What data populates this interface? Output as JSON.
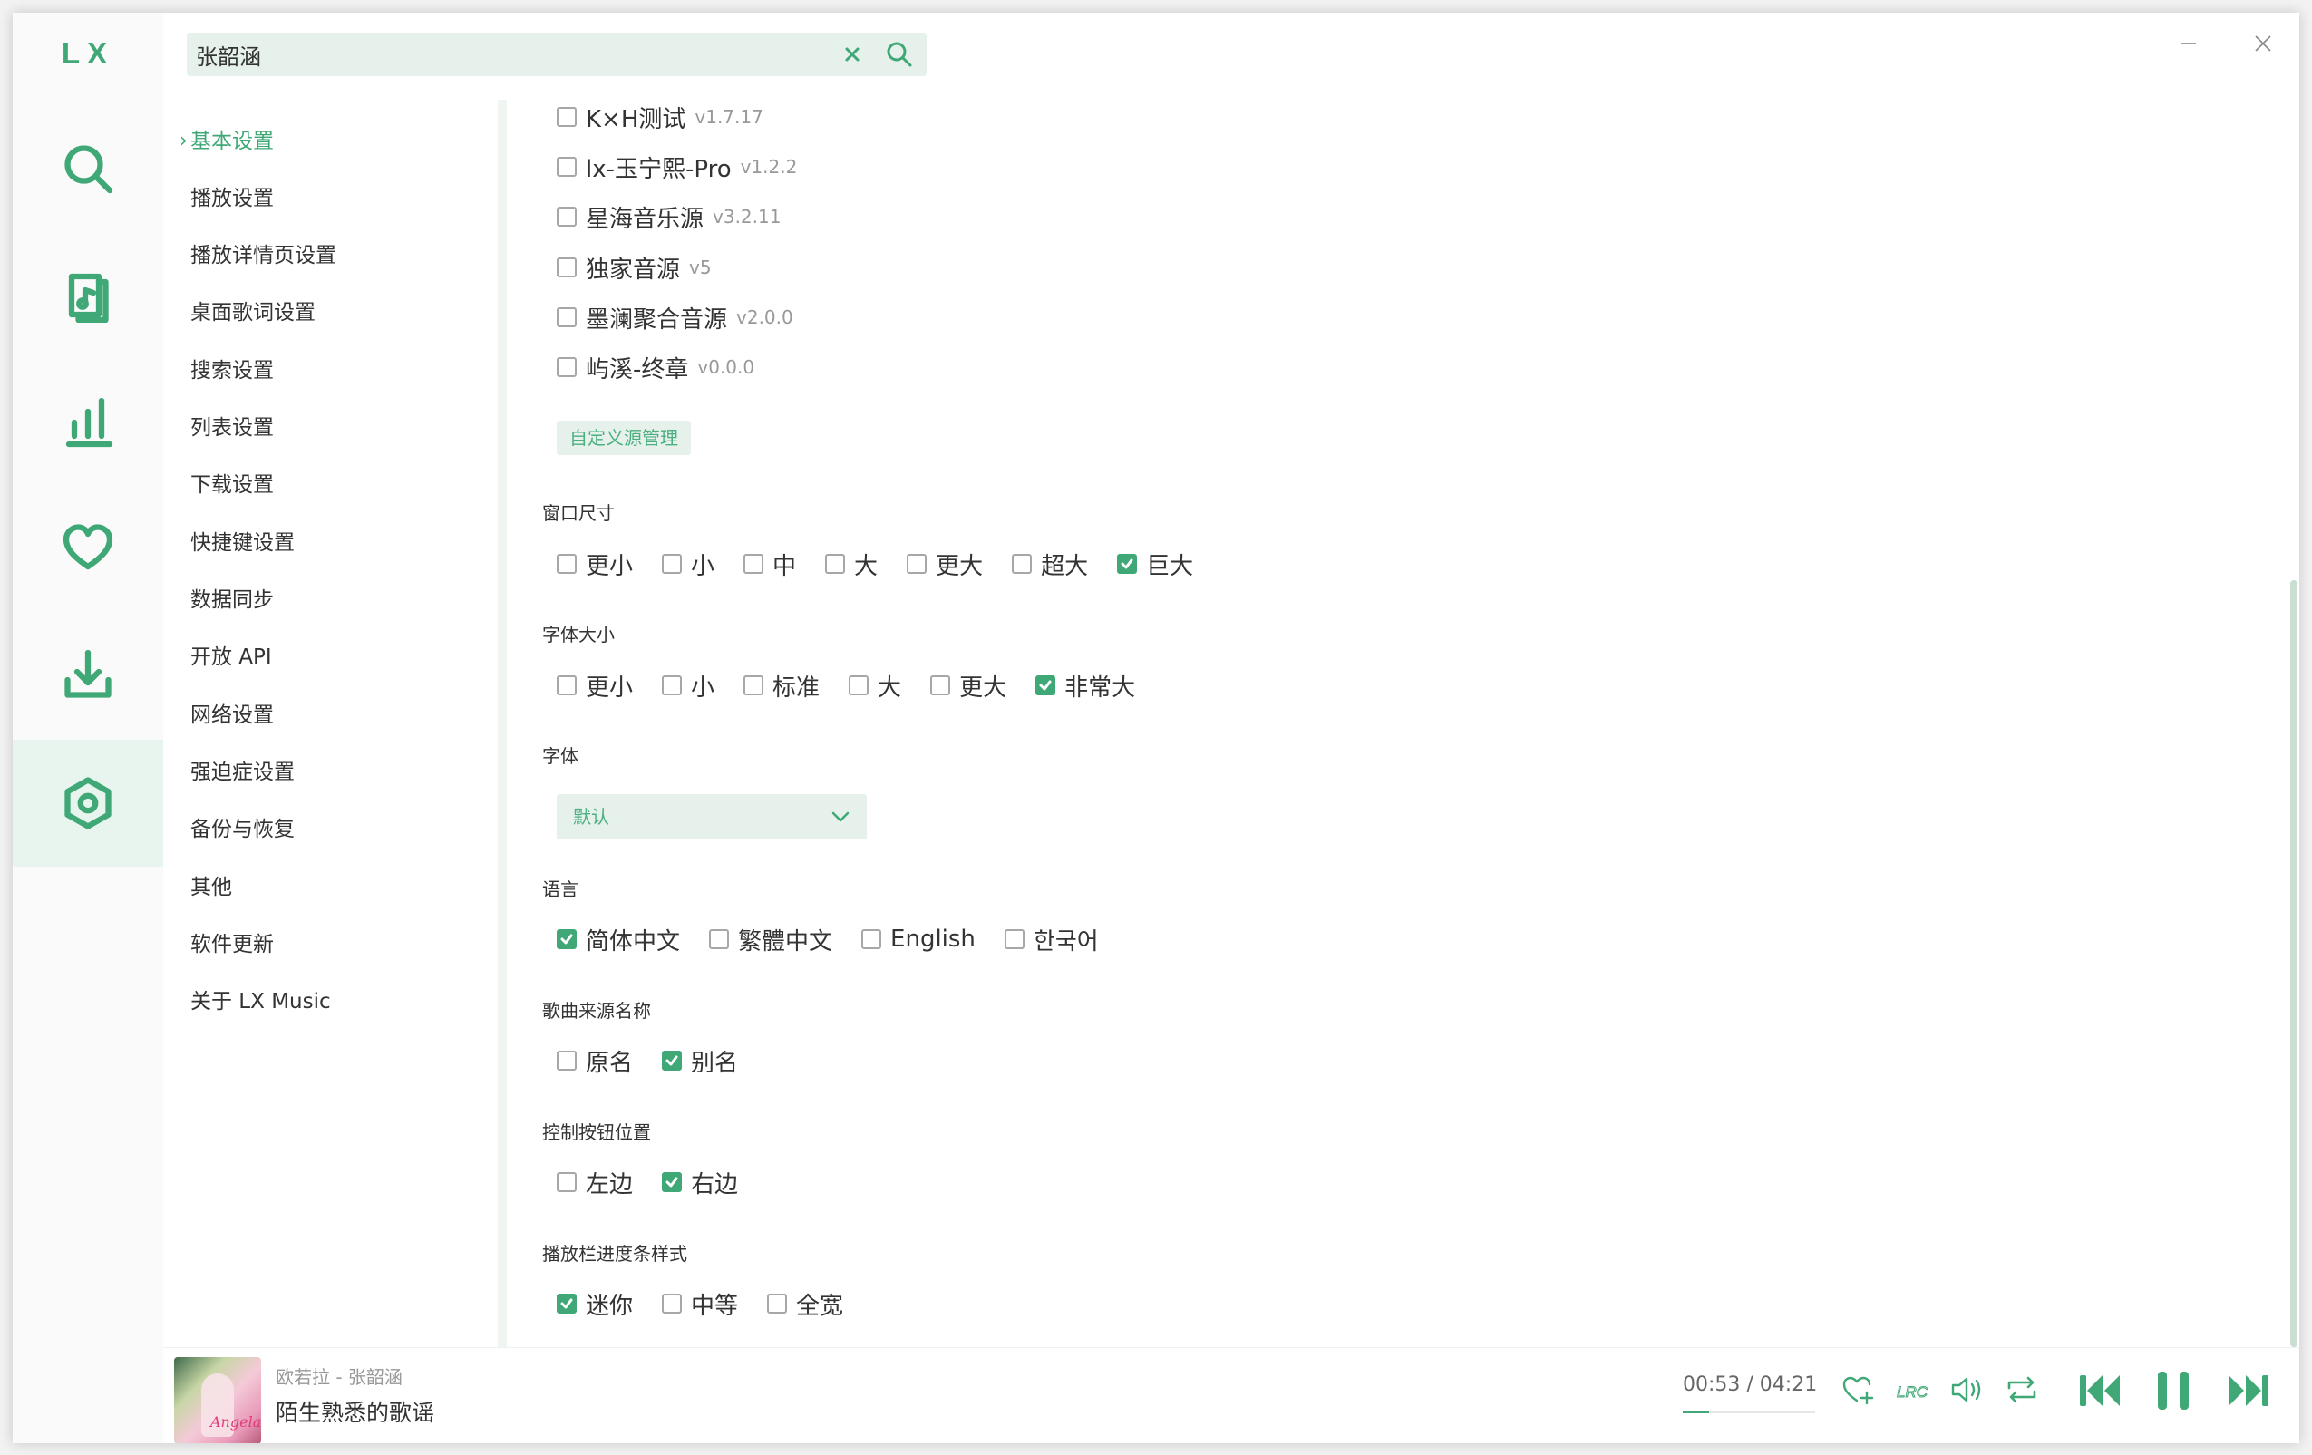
{
  "app": {
    "logo": "LX"
  },
  "colors": {
    "accent": "#3fa876",
    "accent_light": "#e5f1ea"
  },
  "nav": [
    {
      "name": "search",
      "icon": "search-icon"
    },
    {
      "name": "songlist",
      "icon": "music-file-icon"
    },
    {
      "name": "leaderboard",
      "icon": "chart-icon"
    },
    {
      "name": "favorites",
      "icon": "heart-icon"
    },
    {
      "name": "download",
      "icon": "download-icon"
    },
    {
      "name": "settings",
      "icon": "settings-icon",
      "active": true
    }
  ],
  "search": {
    "value": "张韶涵",
    "placeholder": ""
  },
  "settings_nav": [
    {
      "label": "基本设置",
      "active": true
    },
    {
      "label": "播放设置"
    },
    {
      "label": "播放详情页设置"
    },
    {
      "label": "桌面歌词设置"
    },
    {
      "label": "搜索设置"
    },
    {
      "label": "列表设置"
    },
    {
      "label": "下载设置"
    },
    {
      "label": "快捷键设置"
    },
    {
      "label": "数据同步"
    },
    {
      "label": "开放 API"
    },
    {
      "label": "网络设置"
    },
    {
      "label": "强迫症设置"
    },
    {
      "label": "备份与恢复"
    },
    {
      "label": "其他"
    },
    {
      "label": "软件更新"
    },
    {
      "label": "关于 LX Music"
    }
  ],
  "sources": [
    {
      "name": "K×H测试",
      "version": "v1.7.17",
      "checked": false
    },
    {
      "name": "lx-玉宁熙-Pro",
      "version": "v1.2.2",
      "checked": false
    },
    {
      "name": "星海音乐源",
      "version": "v3.2.11",
      "checked": false
    },
    {
      "name": "独家音源",
      "version": "v5",
      "checked": false
    },
    {
      "name": "墨澜聚合音源",
      "version": "v2.0.0",
      "checked": false
    },
    {
      "name": "屿溪-终章",
      "version": "v0.0.0",
      "checked": false
    }
  ],
  "custom_source_button": "自定义源管理",
  "window_size": {
    "title": "窗口尺寸",
    "options": [
      {
        "label": "更小",
        "checked": false
      },
      {
        "label": "小",
        "checked": false
      },
      {
        "label": "中",
        "checked": false
      },
      {
        "label": "大",
        "checked": false
      },
      {
        "label": "更大",
        "checked": false
      },
      {
        "label": "超大",
        "checked": false
      },
      {
        "label": "巨大",
        "checked": true
      }
    ]
  },
  "font_size": {
    "title": "字体大小",
    "options": [
      {
        "label": "更小",
        "checked": false
      },
      {
        "label": "小",
        "checked": false
      },
      {
        "label": "标准",
        "checked": false
      },
      {
        "label": "大",
        "checked": false
      },
      {
        "label": "更大",
        "checked": false
      },
      {
        "label": "非常大",
        "checked": true
      }
    ]
  },
  "font": {
    "title": "字体",
    "value": "默认"
  },
  "language": {
    "title": "语言",
    "options": [
      {
        "label": "简体中文",
        "checked": true
      },
      {
        "label": "繁體中文",
        "checked": false
      },
      {
        "label": "English",
        "checked": false
      },
      {
        "label": "한국어",
        "checked": false
      }
    ]
  },
  "source_name": {
    "title": "歌曲来源名称",
    "options": [
      {
        "label": "原名",
        "checked": false
      },
      {
        "label": "别名",
        "checked": true
      }
    ]
  },
  "control_position": {
    "title": "控制按钮位置",
    "options": [
      {
        "label": "左边",
        "checked": false
      },
      {
        "label": "右边",
        "checked": true
      }
    ]
  },
  "progress_style": {
    "title": "播放栏进度条样式",
    "options": [
      {
        "label": "迷你",
        "checked": true
      },
      {
        "label": "中等",
        "checked": false
      },
      {
        "label": "全宽",
        "checked": false
      }
    ]
  },
  "player": {
    "meta": "欧若拉 - 张韶涵",
    "song": "陌生熟悉的歌谣",
    "time": "00:53 / 04:21",
    "progress": 0.2,
    "cover_text": "Angela"
  }
}
